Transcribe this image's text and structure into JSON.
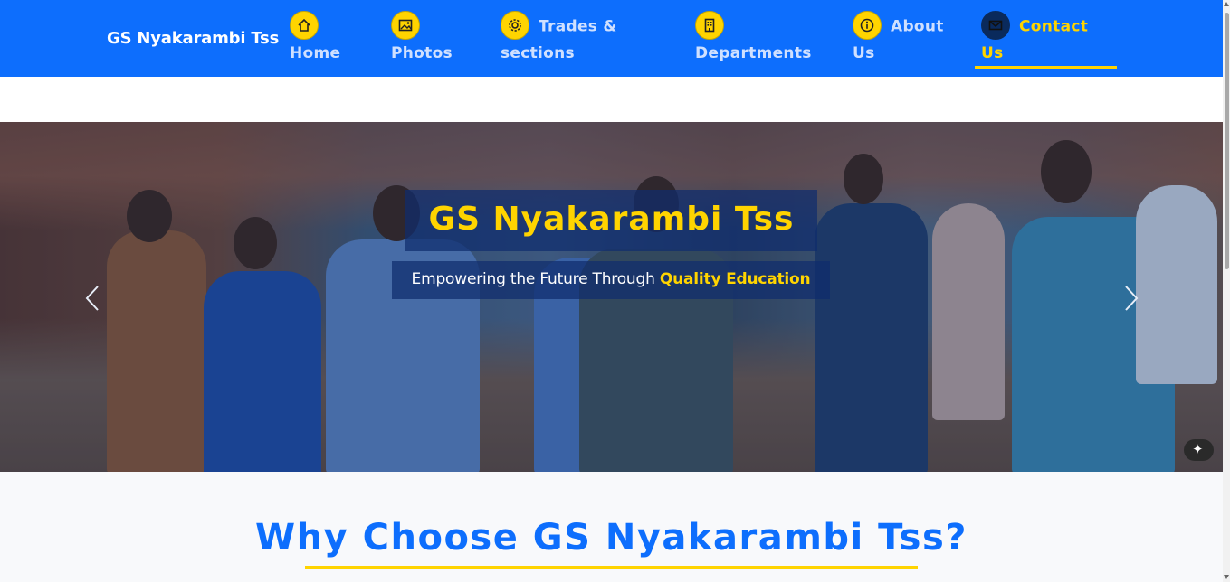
{
  "navbar": {
    "brand": "GS Nyakarambi Tss",
    "items": [
      {
        "line1": "",
        "line2": "Home",
        "icon": "home-icon"
      },
      {
        "line1": "",
        "line2": "Photos",
        "icon": "image-icon"
      },
      {
        "line1": "Trades &",
        "line2": "sections",
        "icon": "gear-icon"
      },
      {
        "line1": "",
        "line2": "Departments",
        "icon": "building-icon"
      },
      {
        "line1": "About",
        "line2": "Us",
        "icon": "info-icon"
      },
      {
        "line1": "Contact",
        "line2": "Us",
        "icon": "envelope-icon",
        "active": true
      }
    ],
    "colors": {
      "background": "#0d6efd",
      "accent": "#ffd400",
      "link": "#cfe0ff"
    }
  },
  "hero": {
    "title": "GS Nyakarambi Tss",
    "subtitle_prefix": "Empowering the Future Through ",
    "subtitle_highlight": "Quality Education",
    "prev_icon": "chevron-left-icon",
    "next_icon": "chevron-right-icon",
    "image_subject": "school-staff-walking-photo",
    "magic_icon": "magic-wand-icon"
  },
  "why": {
    "title": "Why Choose GS Nyakarambi Tss?",
    "color": "#0d6efd"
  }
}
